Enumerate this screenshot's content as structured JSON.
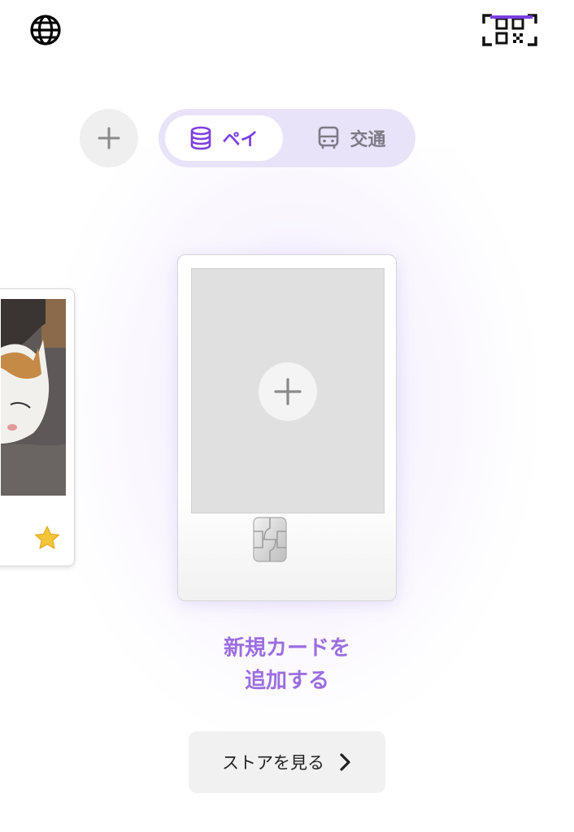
{
  "header": {
    "language_icon": "globe-icon",
    "scan_icon": "qr-scan-icon"
  },
  "tabs": [
    {
      "label": "ペイ",
      "icon": "coin-stack-icon",
      "active": true
    },
    {
      "label": "交通",
      "icon": "bus-icon",
      "active": false
    }
  ],
  "add_button_icon": "plus-icon",
  "cards": {
    "peek_favorite_icon": "star-icon",
    "new_card_label_line1": "新規カードを",
    "new_card_label_line2": "追加する"
  },
  "store_button": {
    "label": "ストアを見る",
    "icon": "chevron-right-icon"
  },
  "colors": {
    "accent": "#7a3fe0",
    "accent_light": "#9b6ee0",
    "segment_bg": "#e9e3f9",
    "star": "#f4c53a"
  }
}
